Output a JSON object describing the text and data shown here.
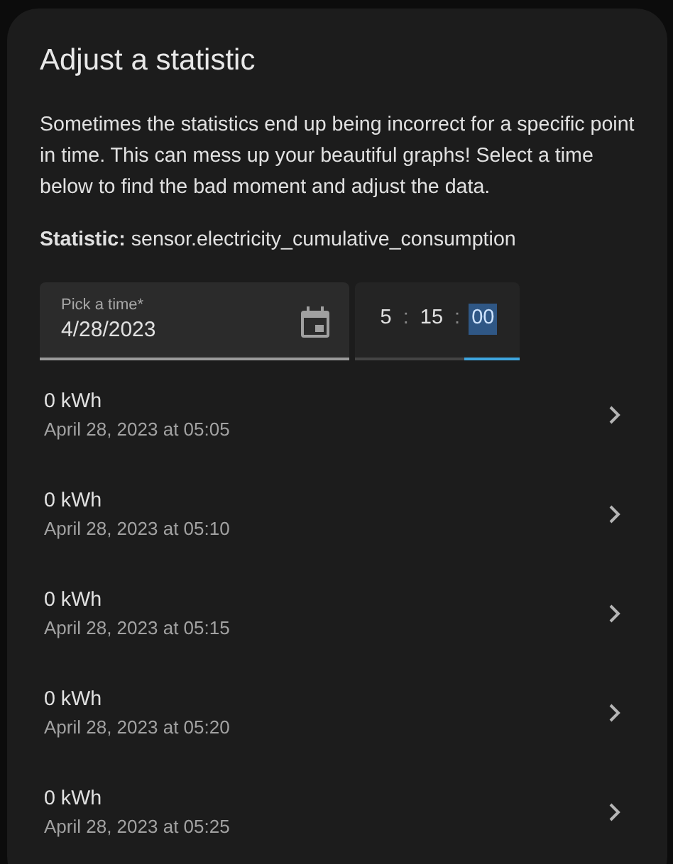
{
  "dialog": {
    "title": "Adjust a statistic",
    "description": "Sometimes the statistics end up being incorrect for a specific point in time. This can mess up your beautiful graphs! Select a time below to find the bad moment and adjust the data.",
    "statistic": "**Statistic:** sensor.electricity_cumulative_consumption",
    "date_field": {
      "label": "Pick a time*",
      "value": "4/28/2023"
    },
    "time_field": {
      "segments": [
        {
          "value": "5",
          "selected": false
        },
        {
          "value": "15",
          "selected": false
        },
        {
          "value": "00",
          "selected": true
        }
      ],
      "separator": ":"
    },
    "entries": [
      {
        "value": "0 kWh",
        "time": "April 28, 2023 at 05:05"
      },
      {
        "value": "0 kWh",
        "time": "April 28, 2023 at 05:10"
      },
      {
        "value": "0 kWh",
        "time": "April 28, 2023 at 05:15"
      },
      {
        "value": "0 kWh",
        "time": "April 28, 2023 at 05:20"
      },
      {
        "value": "0 kWh",
        "time": "April 28, 2023 at 05:25"
      }
    ]
  }
}
